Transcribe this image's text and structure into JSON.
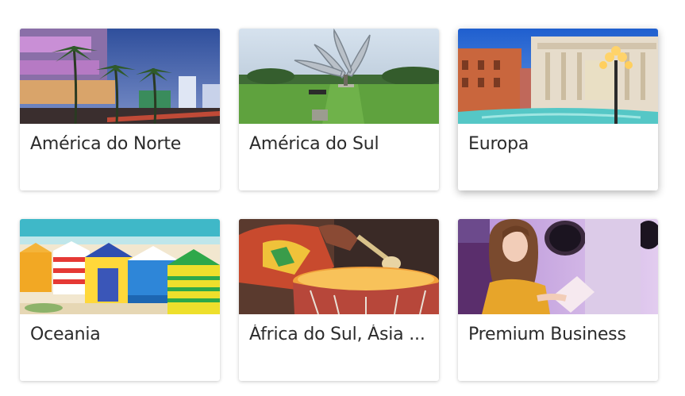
{
  "destinations": [
    {
      "label": "América do Norte",
      "image": "miami-beach-palms-photo"
    },
    {
      "label": "América do Sul",
      "image": "buenos-aires-floralis-sculpture-photo"
    },
    {
      "label": "Europa",
      "image": "rome-trevi-fountain-photo"
    },
    {
      "label": "Oceania",
      "image": "brighton-beach-huts-photo"
    },
    {
      "label": "África do Sul, Ásia ...",
      "image": "african-drum-player-photo"
    },
    {
      "label": "Premium Business",
      "image": "premium-cabin-passenger-photo"
    }
  ]
}
